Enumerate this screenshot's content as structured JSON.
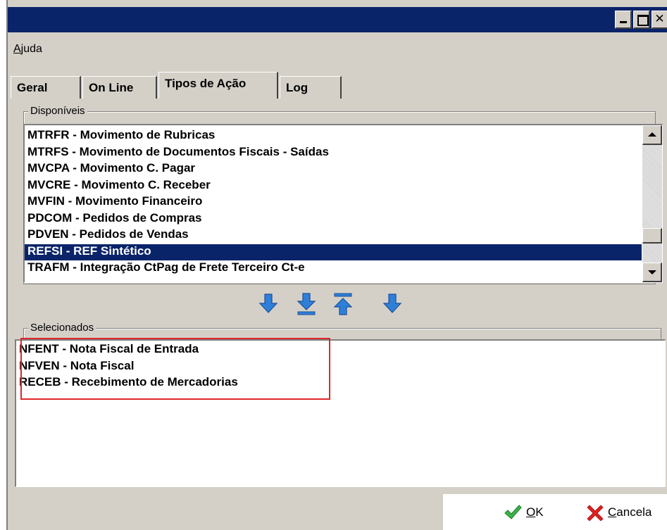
{
  "menu": {
    "items": [
      "Ajuda"
    ]
  },
  "tabs": [
    {
      "label": "Geral",
      "active": false
    },
    {
      "label": "On Line",
      "active": false
    },
    {
      "label": "Tipos de Ação",
      "active": true
    },
    {
      "label": "Log",
      "active": false
    }
  ],
  "disponiveis": {
    "label": "Disponíveis",
    "items": [
      "MTRFR - Movimento de Rubricas",
      "MTRFS - Movimento de Documentos Fiscais - Saídas",
      "MVCPA - Movimento C. Pagar",
      "MVCRE - Movimento C. Receber",
      "MVFIN - Movimento Financeiro",
      "PDCOM - Pedidos de Compras",
      "PDVEN - Pedidos de Vendas",
      "REFSI - REF Sintético",
      "TRAFM - Integração CtPag de Frete Terceiro Ct-e"
    ],
    "selected_index": 7
  },
  "transfer_buttons": [
    "arrow-down-icon",
    "move-to-bottom-icon",
    "move-to-top-icon",
    "arrow-down-icon"
  ],
  "selecionados": {
    "label": "Selecionados",
    "items": [
      "NFENT - Nota Fiscal de Entrada",
      "NFVEN - Nota Fiscal",
      "RECEB - Recebimento de Mercadorias"
    ]
  },
  "buttons": {
    "ok": "OK",
    "cancel": "Cancela"
  },
  "colors": {
    "title_bar": "#0a246a",
    "selection": "#0a246a",
    "highlight_border": "#e0262a",
    "arrow_blue": "#2f7fd8",
    "ok_green": "#3bb34a",
    "cancel_red": "#e02020"
  }
}
